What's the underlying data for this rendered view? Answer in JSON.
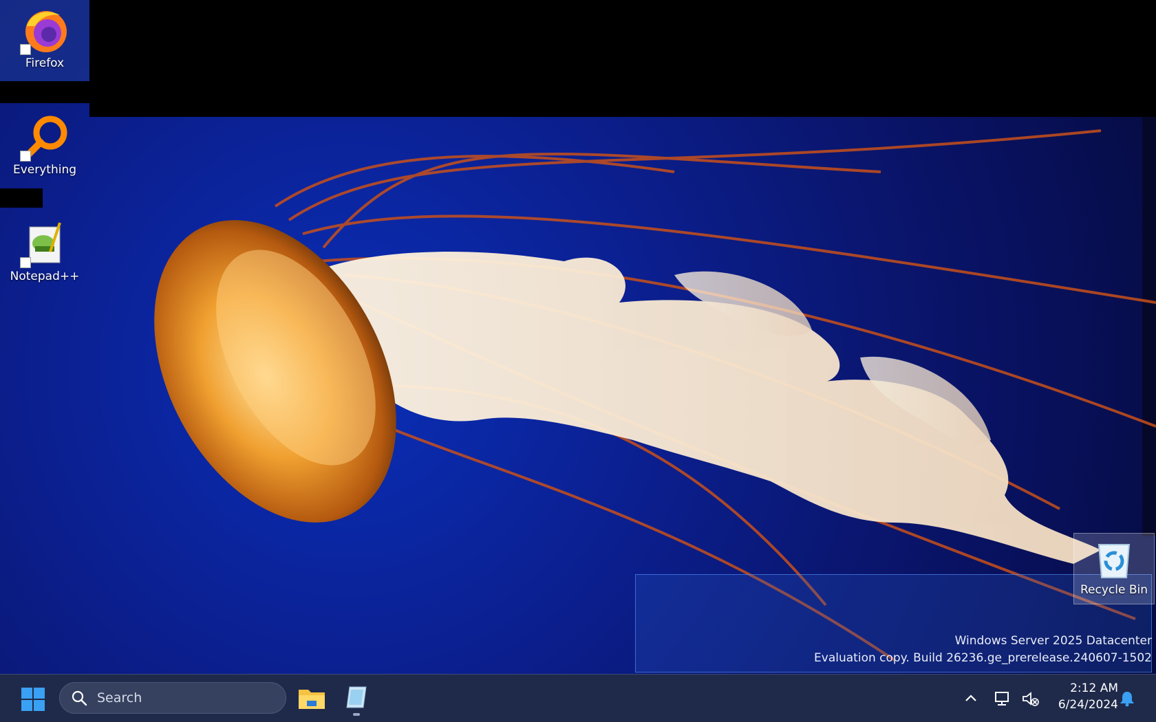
{
  "desktop": {
    "icons": [
      {
        "label": "Firefox",
        "icon": "firefox-icon"
      },
      {
        "label": "Everything",
        "icon": "everything-search-icon"
      },
      {
        "label": "Notepad++",
        "icon": "notepadpp-icon"
      }
    ],
    "recycle_bin": {
      "label": "Recycle Bin",
      "icon": "recycle-bin-icon"
    },
    "watermark": {
      "line1": "Windows Server 2025 Datacenter",
      "line2": "Evaluation copy. Build 26236.ge_prerelease.240607-1502"
    }
  },
  "taskbar": {
    "start_icon": "windows-start-icon",
    "search": {
      "label": "Search",
      "icon": "search-icon"
    },
    "pinned": [
      {
        "name": "File Explorer",
        "icon": "folder-icon"
      },
      {
        "name": "App",
        "icon": "app-tile-icon"
      }
    ],
    "tray": {
      "chevron_icon": "chevron-up-icon",
      "network_icon": "network-icon",
      "volume_icon": "volume-muted-icon",
      "time": "2:12 AM",
      "date": "6/24/2024",
      "notification_icon": "bell-icon"
    }
  },
  "colors": {
    "wallpaper_blue": "#0b1f8f",
    "taskbar": "#1f2a4a",
    "accent": "#3a8ee6"
  }
}
